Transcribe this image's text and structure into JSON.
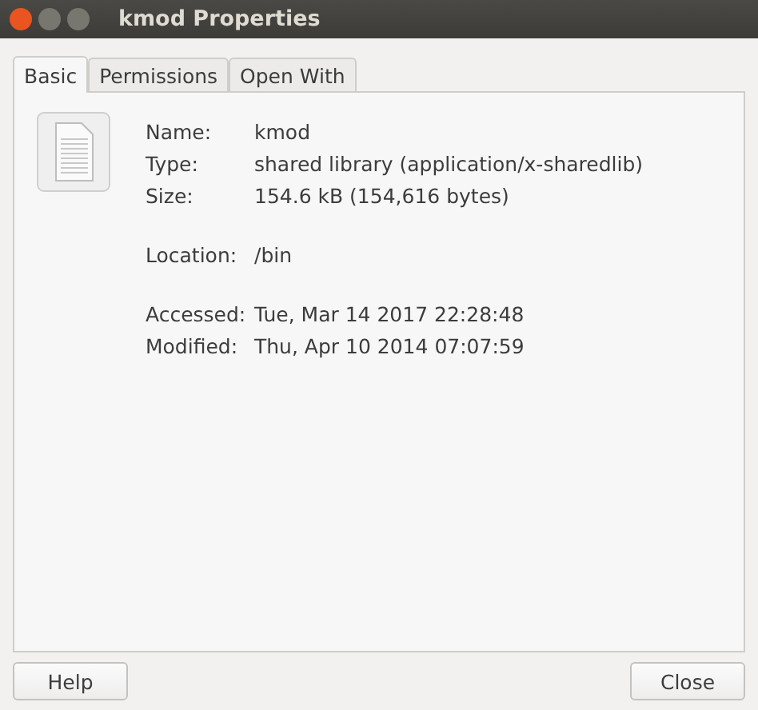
{
  "window": {
    "title": "kmod Properties"
  },
  "tabs": [
    {
      "label": "Basic",
      "selected": true
    },
    {
      "label": "Permissions",
      "selected": false
    },
    {
      "label": "Open With",
      "selected": false
    }
  ],
  "groups": [
    [
      {
        "label": "Name:",
        "value": "kmod"
      },
      {
        "label": "Type:",
        "value": "shared library (application/x-sharedlib)"
      },
      {
        "label": "Size:",
        "value": "154.6 kB (154,616 bytes)"
      }
    ],
    [
      {
        "label": "Location:",
        "value": "/bin"
      }
    ],
    [
      {
        "label": "Accessed:",
        "value": "Tue, Mar 14 2017 22:28:48"
      },
      {
        "label": "Modified:",
        "value": "Thu, Apr 10 2014 07:07:59"
      }
    ]
  ],
  "buttons": [
    "Help",
    "Close"
  ]
}
